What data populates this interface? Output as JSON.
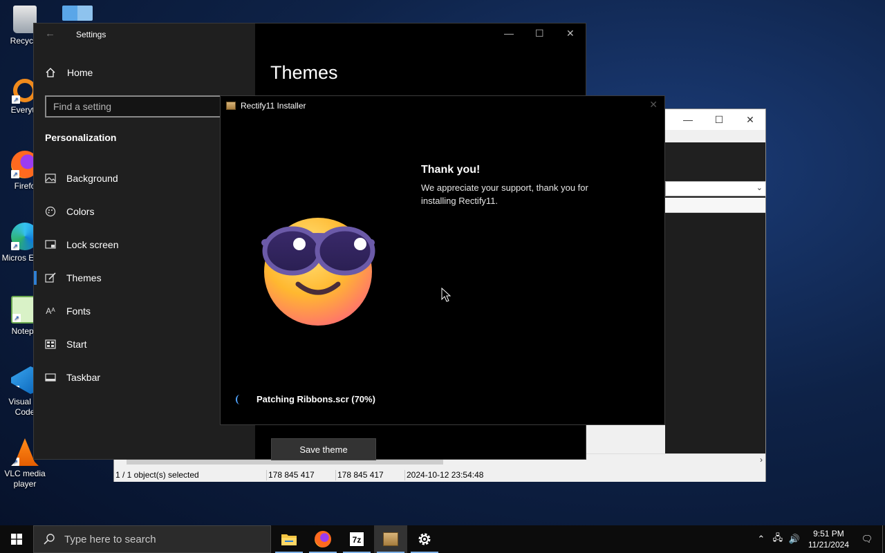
{
  "desktop": {
    "icons": [
      {
        "label": "Recycle"
      },
      {
        "label": "Everyth"
      },
      {
        "label": "Firefo"
      },
      {
        "label": "Micros Edge"
      },
      {
        "label": "Notepa"
      },
      {
        "label": "Visual St Code"
      },
      {
        "label": "VLC media player"
      }
    ]
  },
  "settings": {
    "title": "Settings",
    "home_label": "Home",
    "search_placeholder": "Find a setting",
    "section": "Personalization",
    "nav": [
      {
        "label": "Background",
        "icon": "image-icon"
      },
      {
        "label": "Colors",
        "icon": "palette-icon"
      },
      {
        "label": "Lock screen",
        "icon": "lock-screen-icon"
      },
      {
        "label": "Themes",
        "icon": "brush-icon",
        "active": true
      },
      {
        "label": "Fonts",
        "icon": "font-icon"
      },
      {
        "label": "Start",
        "icon": "start-icon"
      },
      {
        "label": "Taskbar",
        "icon": "taskbar-icon"
      }
    ],
    "page_title": "Themes",
    "save_theme_label": "Save theme"
  },
  "installer": {
    "title": "Rectify11 Installer",
    "heading": "Thank you!",
    "message": "We appreciate your support, thank you for installing Rectify11.",
    "progress_text": "Patching Ribbons.scr (70%)",
    "progress_percent": 70
  },
  "file_manager": {
    "status": {
      "selected": "1 / 1 object(s) selected",
      "size1": "178 845 417",
      "size2": "178 845 417",
      "modified": "2024-10-12 23:54:48"
    }
  },
  "taskbar": {
    "search_placeholder": "Type here to search",
    "time": "9:51 PM",
    "date": "11/21/2024"
  },
  "colors": {
    "accent": "#2f7fd4",
    "taskbar": "#0c0c0c",
    "settings_sidebar": "#1f1f1f"
  }
}
